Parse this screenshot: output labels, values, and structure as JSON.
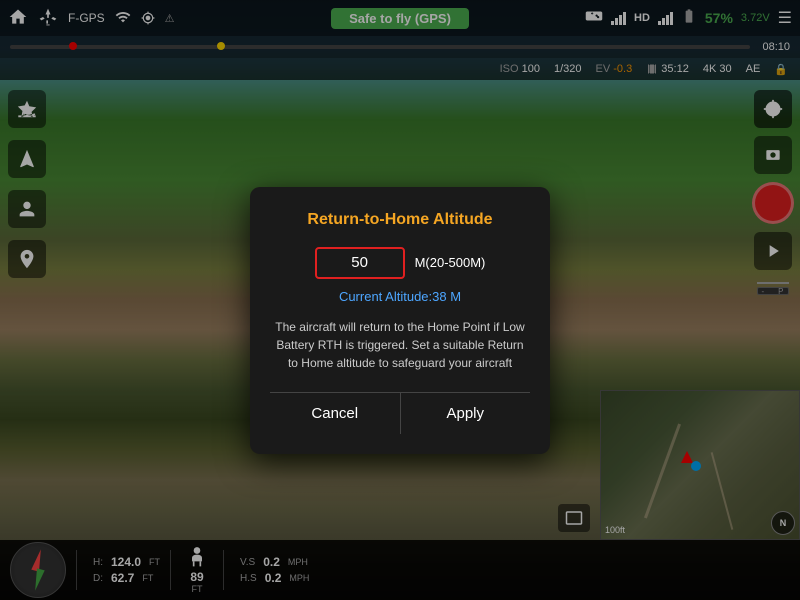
{
  "topbar": {
    "home_icon": "🏠",
    "drone_icon": "✈",
    "drone_id": "F-GPS",
    "signal_icon": "📶",
    "warning_icon": "⚠",
    "status_label": "Safe to fly (GPS)",
    "remote_icon": "🎮",
    "hd_label": "HD",
    "battery_icon": "🔋",
    "battery_percent": "57%",
    "battery_voltage": "3.72V",
    "menu_icon": "☰"
  },
  "secondbar": {
    "time": "08:10",
    "iso_label": "ISO",
    "iso_val": "100",
    "shutter": "1/320",
    "ev_label": "EV",
    "ev_val": "-0.3",
    "frames_label": "35:12",
    "res_label": "4K",
    "fps_label": "30",
    "ae_label": "AE",
    "lock_icon": "🔒"
  },
  "dialog": {
    "title": "Return-to-Home Altitude",
    "input_value": "50",
    "range_label": "M(20-500M)",
    "current_label": "Current Altitude:38 M",
    "description": "The aircraft will return to the Home Point if Low Battery RTH is triggered. Set a suitable Return to Home altitude to safeguard your aircraft",
    "cancel_label": "Cancel",
    "apply_label": "Apply"
  },
  "bottombar": {
    "h_label": "H:",
    "h_val": "124.0",
    "h_unit": "FT",
    "d_label": "D:",
    "d_val": "62.7",
    "d_unit": "FT",
    "vs_label": "V.S",
    "vs_val": "0.2",
    "vs_unit": "MPH",
    "hs_label": "H.S",
    "hs_val": "0.2",
    "hs_unit": "MPH",
    "altitude_val": "89",
    "altitude_unit": "FT"
  },
  "minimap": {
    "scale_label": "100ft",
    "compass_label": "N"
  },
  "timeline": {
    "time_display": "08:10"
  }
}
